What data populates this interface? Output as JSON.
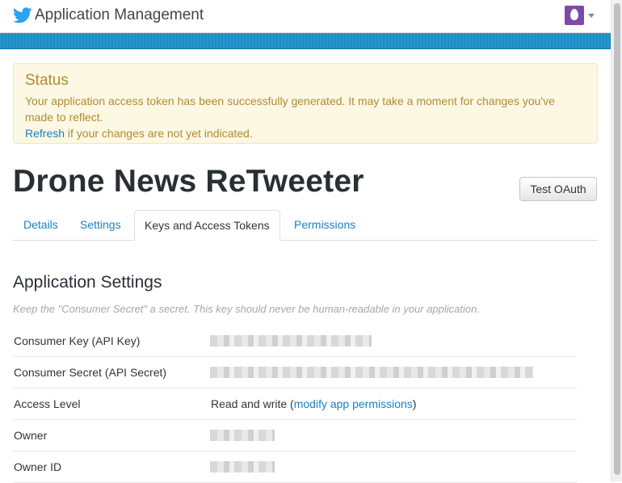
{
  "header": {
    "brand_icon": "twitter-bird-icon",
    "title": "Application Management",
    "avatar_icon": "egg-avatar-icon"
  },
  "status": {
    "title": "Status",
    "message": "Your application access token has been successfully generated. It may take a moment for changes you've made to reflect.",
    "refresh_link": "Refresh",
    "refresh_suffix": " if your changes are not yet indicated."
  },
  "app": {
    "title": "Drone News ReTweeter",
    "test_button": "Test OAuth"
  },
  "tabs": [
    {
      "label": "Details",
      "active": false
    },
    {
      "label": "Settings",
      "active": false
    },
    {
      "label": "Keys and Access Tokens",
      "active": true
    },
    {
      "label": "Permissions",
      "active": false
    }
  ],
  "settings": {
    "title": "Application Settings",
    "note": "Keep the \"Consumer Secret\" a secret. This key should never be human-readable in your application.",
    "rows": [
      {
        "label": "Consumer Key (API Key)",
        "value": "",
        "redacted": true
      },
      {
        "label": "Consumer Secret (API Secret)",
        "value": "",
        "redacted": true
      },
      {
        "label": "Access Level",
        "value": "Read and write (",
        "link": "modify app permissions",
        "suffix": ")"
      },
      {
        "label": "Owner",
        "value": "",
        "redacted": true
      },
      {
        "label": "Owner ID",
        "value": "",
        "redacted": true
      }
    ]
  },
  "colors": {
    "accent_blue": "#1d8dc6",
    "link": "#1a81c4",
    "warning_bg": "#fcf8e3",
    "warning_text": "#b38a34",
    "avatar": "#7e4aa9"
  }
}
